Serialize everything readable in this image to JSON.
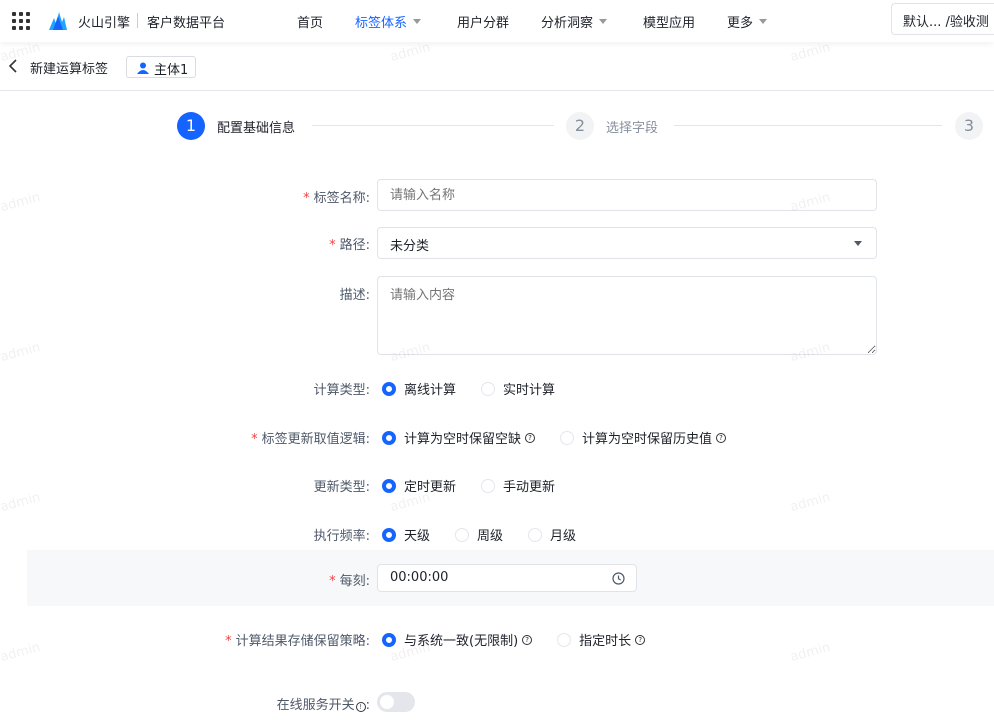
{
  "header": {
    "brand": "火山引擎",
    "product": "客户数据平台",
    "nav": [
      {
        "label": "首页"
      },
      {
        "label": "标签体系"
      },
      {
        "label": "用户分群"
      },
      {
        "label": "分析洞察"
      },
      {
        "label": "模型应用"
      },
      {
        "label": "更多"
      }
    ],
    "project": "默认...   /验收测"
  },
  "page": {
    "title": "新建运算标签",
    "subject": "主体1"
  },
  "steps": [
    {
      "num": "1",
      "label": "配置基础信息"
    },
    {
      "num": "2",
      "label": "选择字段"
    },
    {
      "num": "3",
      "label": ""
    }
  ],
  "form": {
    "name": {
      "label": "标签名称:",
      "placeholder": "请输入名称"
    },
    "path": {
      "label": "路径:",
      "value": "未分类"
    },
    "desc": {
      "label": "描述:",
      "placeholder": "请输入内容"
    },
    "calc_type": {
      "label": "计算类型:",
      "options": [
        "离线计算",
        "实时计算"
      ]
    },
    "update_logic": {
      "label": "标签更新取值逻辑:",
      "options": [
        "计算为空时保留空缺",
        "计算为空时保留历史值"
      ]
    },
    "update_type": {
      "label": "更新类型:",
      "options": [
        "定时更新",
        "手动更新"
      ]
    },
    "frequency": {
      "label": "执行频率:",
      "options": [
        "天级",
        "周级",
        "月级"
      ]
    },
    "time": {
      "label": "每刻:",
      "value": "00:00:00"
    },
    "storage": {
      "label": "计算结果存储保留策略:",
      "options": [
        "与系统一致(无限制)",
        "指定时长"
      ]
    },
    "online": {
      "label": "在线服务开关",
      "enabled": false
    }
  },
  "watermark": "admin",
  "colors": {
    "accent": "#1664ff",
    "required": "#f53f3f"
  }
}
